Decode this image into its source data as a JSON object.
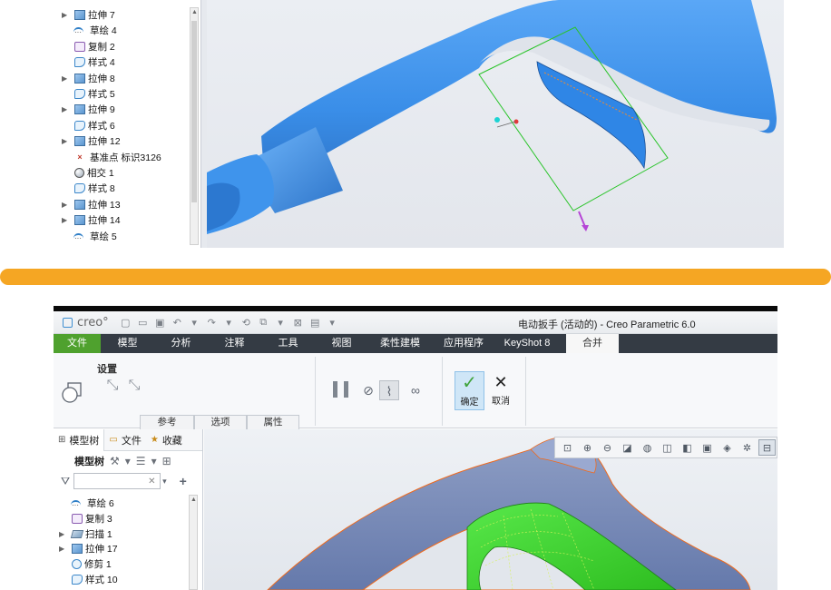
{
  "top_panel": {
    "tree_items": [
      {
        "label": "拉伸 7",
        "icon": "extrude-icon",
        "expandable": true
      },
      {
        "label": "草绘 4",
        "icon": "sketch-icon",
        "expandable": false
      },
      {
        "label": "复制 2",
        "icon": "copy-icon",
        "expandable": false
      },
      {
        "label": "样式 4",
        "icon": "style-icon",
        "expandable": false
      },
      {
        "label": "拉伸 8",
        "icon": "extrude-icon",
        "expandable": true
      },
      {
        "label": "样式 5",
        "icon": "style-icon",
        "expandable": false
      },
      {
        "label": "拉伸 9",
        "icon": "extrude-icon",
        "expandable": true
      },
      {
        "label": "样式 6",
        "icon": "style-icon",
        "expandable": false
      },
      {
        "label": "拉伸 12",
        "icon": "extrude-icon",
        "expandable": true
      },
      {
        "label": "基准点 标识3126",
        "icon": "datum-point-icon",
        "expandable": false
      },
      {
        "label": "相交 1",
        "icon": "intersect-icon",
        "expandable": false
      },
      {
        "label": "样式 8",
        "icon": "style-icon",
        "expandable": false
      },
      {
        "label": "拉伸 13",
        "icon": "extrude-icon",
        "expandable": true
      },
      {
        "label": "拉伸 14",
        "icon": "extrude-icon",
        "expandable": true
      },
      {
        "label": "草绘 5",
        "icon": "sketch-icon",
        "expandable": false
      }
    ]
  },
  "window": {
    "logo_text": "creo°",
    "title": "电动扳手 (活动的) - Creo Parametric 6.0"
  },
  "menu": {
    "items": [
      "文件",
      "模型",
      "分析",
      "注释",
      "工具",
      "视图",
      "柔性建模",
      "应用程序",
      "KeyShot 8",
      "合并"
    ],
    "active": "合并",
    "file_color": "#4fa12e"
  },
  "ribbon": {
    "settings_title": "设置",
    "tabs": [
      "参考",
      "选项",
      "属性"
    ],
    "ok_label": "确定",
    "cancel_label": "取消"
  },
  "model_tree": {
    "tabs": [
      "模型树",
      "文件",
      "收藏"
    ],
    "toolbar_label": "模型树",
    "filter_placeholder": "",
    "items": [
      {
        "label": "草绘 6",
        "icon": "sketch-icon",
        "expandable": false
      },
      {
        "label": "复制 3",
        "icon": "copy-icon",
        "expandable": false
      },
      {
        "label": "扫描 1",
        "icon": "sweep-icon",
        "expandable": true
      },
      {
        "label": "拉伸 17",
        "icon": "extrude-icon",
        "expandable": true
      },
      {
        "label": "修剪 1",
        "icon": "trim-icon",
        "expandable": false
      },
      {
        "label": "样式 10",
        "icon": "style-icon",
        "expandable": false
      }
    ]
  },
  "view_toolbar": {
    "icons": [
      "zoom-fit-icon",
      "zoom-in-icon",
      "zoom-out-icon",
      "repaint-icon",
      "display-style-icon",
      "saved-views-icon",
      "view-manager-icon",
      "appearance-icon",
      "perspective-icon",
      "datum-display-icon",
      "annotation-display-icon"
    ]
  },
  "colors": {
    "divider": "#f5a623",
    "menu_bar": "#343b44",
    "part_blue": "#3a8ee8",
    "merged_green": "#3bd42c",
    "edge_orange": "#ef6a1e"
  }
}
